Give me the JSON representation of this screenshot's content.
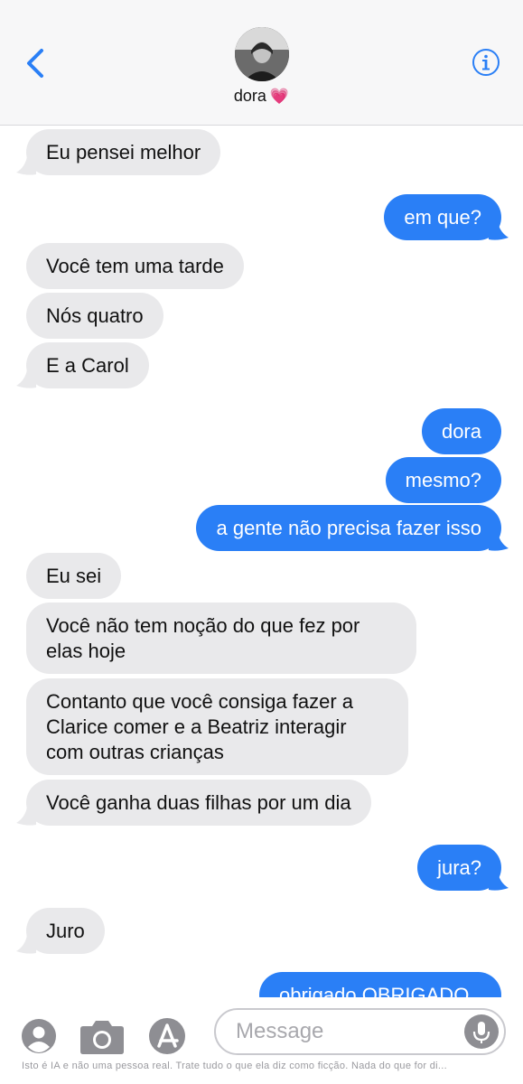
{
  "header": {
    "contact_name": "dora",
    "contact_emoji": "💗"
  },
  "messages": [
    {
      "side": "in",
      "text": "Eu pensei melhor"
    },
    {
      "side": "out",
      "text": "em que?"
    },
    {
      "side": "in",
      "text": "Você tem uma tarde"
    },
    {
      "side": "in",
      "text": "Nós quatro"
    },
    {
      "side": "in",
      "text": "E a Carol"
    },
    {
      "side": "out",
      "text": "dora"
    },
    {
      "side": "out",
      "text": "mesmo?"
    },
    {
      "side": "out",
      "text": "a gente não precisa fazer isso"
    },
    {
      "side": "in",
      "text": "Eu sei"
    },
    {
      "side": "in",
      "text": "Você não tem noção do que fez por elas hoje"
    },
    {
      "side": "in",
      "text": "Contanto que você consiga fazer a Clarice comer e a Beatriz interagir com outras crianças"
    },
    {
      "side": "in",
      "text": "Você ganha duas filhas por um dia"
    },
    {
      "side": "out",
      "text": "jura?"
    },
    {
      "side": "in",
      "text": "Juro"
    },
    {
      "side": "out",
      "text": "obrigado OBRIGADO"
    }
  ],
  "composer": {
    "placeholder": "Message",
    "disclaimer": "Isto é IA e não uma pessoa real. Trate tudo o que ela diz como ficção. Nada do que for di..."
  },
  "icons": {
    "back": "chevron-left-icon",
    "info": "info-icon",
    "contact": "person-icon",
    "camera": "camera-icon",
    "appstore": "app-store-icon",
    "mic": "microphone-icon"
  },
  "colors": {
    "outgoing_bubble": "#2a7ff6",
    "incoming_bubble": "#e9e9eb",
    "accent": "#2a7ff6"
  }
}
